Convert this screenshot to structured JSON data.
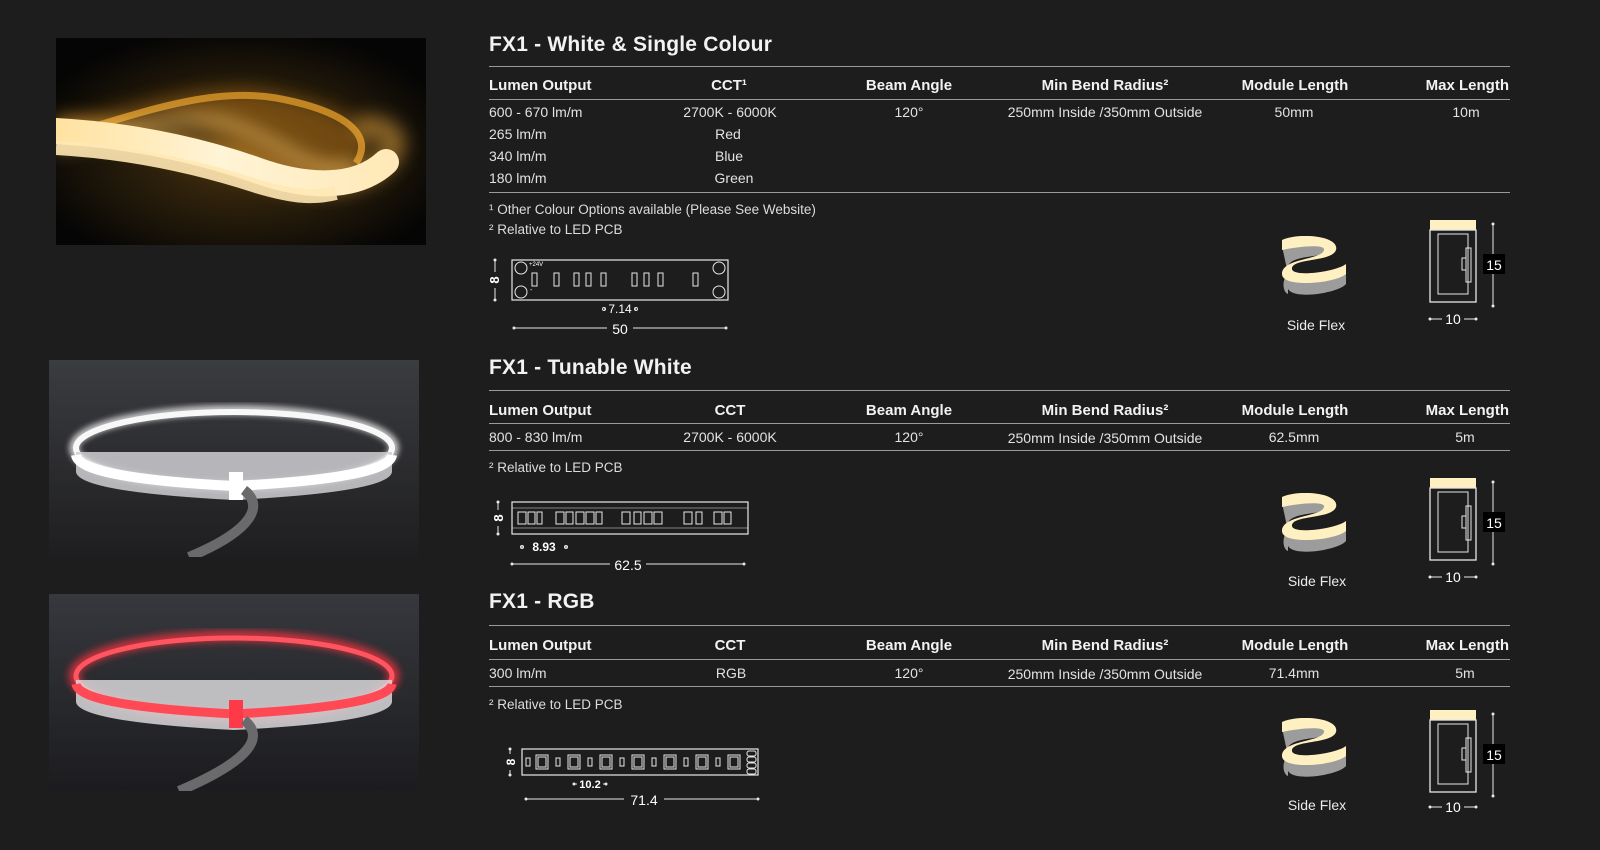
{
  "sections": [
    {
      "title": "FX1 - White & Single Colour",
      "headers": [
        "Lumen Output",
        "CCT¹",
        "Beam Angle",
        "Min Bend Radius²",
        "Module Length",
        "Max Length"
      ],
      "rows": [
        [
          "600 - 670 lm/m",
          "2700K - 6000K",
          "120°",
          "250mm Inside /350mm Outside",
          "50mm",
          "10m"
        ],
        [
          "265 lm/m",
          "Red",
          "",
          "",
          "",
          ""
        ],
        [
          "340 lm/m",
          "Blue",
          "",
          "",
          "",
          ""
        ],
        [
          "180 lm/m",
          "Green",
          "",
          "",
          "",
          ""
        ]
      ],
      "notes": [
        "¹ Other Colour Options available (Please See Website)",
        "² Relative to LED PCB"
      ],
      "pcb": {
        "height_label": "8",
        "pitch_label": "7.14",
        "length_label": "50",
        "voltage_label": "+24V",
        "minus_label": "-"
      },
      "side_flex_label": "Side Flex",
      "profile": {
        "height_label": "15",
        "width_label": "10"
      }
    },
    {
      "title": "FX1 - Tunable White",
      "headers": [
        "Lumen Output",
        "CCT",
        "Beam Angle",
        "Min Bend Radius²",
        "Module Length",
        "Max Length"
      ],
      "rows": [
        [
          "800 - 830 lm/m",
          "2700K - 6000K",
          "120°",
          "250mm Inside /350mm Outside",
          "62.5mm",
          "5m"
        ]
      ],
      "notes": [
        "² Relative to LED PCB"
      ],
      "pcb": {
        "height_label": "8",
        "pitch_label": "8.93",
        "length_label": "62.5"
      },
      "side_flex_label": "Side Flex",
      "profile": {
        "height_label": "15",
        "width_label": "10"
      }
    },
    {
      "title": "FX1 - RGB",
      "headers": [
        "Lumen Output",
        "CCT",
        "Beam Angle",
        "Min Bend Radius²",
        "Module Length",
        "Max Length"
      ],
      "rows": [
        [
          "300 lm/m",
          "RGB",
          "120°",
          "250mm Inside /350mm Outside",
          "71.4mm",
          "5m"
        ]
      ],
      "notes": [
        "² Relative to LED PCB"
      ],
      "pcb": {
        "height_label": "8",
        "pitch_label": "10.2",
        "length_label": "71.4"
      },
      "side_flex_label": "Side Flex",
      "profile": {
        "height_label": "15",
        "width_label": "10"
      }
    }
  ],
  "colors": {
    "background": "#1d1d1d",
    "warm_glow": "#ffe6a8",
    "red_glow": "#ff4a55",
    "rule": "#9a9a9a"
  }
}
